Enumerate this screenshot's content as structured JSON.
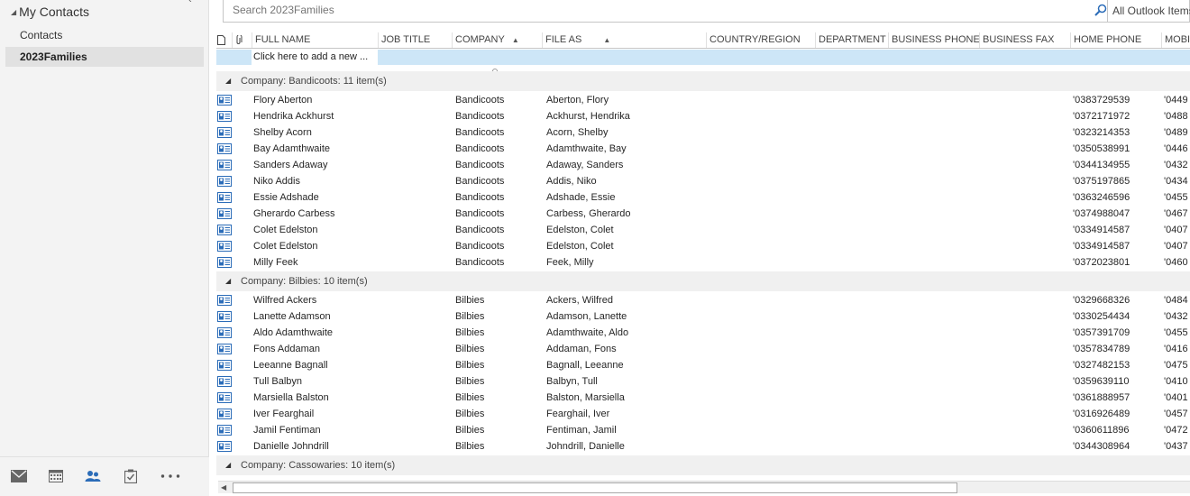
{
  "sidebar": {
    "header": "My Contacts",
    "folders": [
      {
        "label": "Contacts"
      },
      {
        "label": "2023Families"
      }
    ]
  },
  "bottom_nav": [
    "mail-icon",
    "calendar-icon",
    "people-icon",
    "tasks-icon",
    "more-icon"
  ],
  "search": {
    "placeholder": "Search 2023Families",
    "scope": "All Outlook Items"
  },
  "columns": {
    "full_name": "FULL NAME",
    "job_title": "JOB TITLE",
    "company": "COMPANY",
    "file_as": "FILE AS",
    "country": "COUNTRY/REGION",
    "department": "DEPARTMENT",
    "business_phone": "BUSINESS PHONE",
    "business_fax": "BUSINESS FAX",
    "home_phone": "HOME PHONE",
    "mobile": "MOBI"
  },
  "add_new": "Click here to add a new ...",
  "groups": [
    {
      "label": "Company: Bandicoots: 11 item(s)",
      "rows": [
        {
          "name": "Flory Aberton",
          "company": "Bandicoots",
          "file_as": "Aberton, Flory",
          "home": "'0383729539",
          "mobile": "'0449"
        },
        {
          "name": "Hendrika Ackhurst",
          "company": "Bandicoots",
          "file_as": "Ackhurst, Hendrika",
          "home": "'0372171972",
          "mobile": "'0488"
        },
        {
          "name": "Shelby Acorn",
          "company": "Bandicoots",
          "file_as": "Acorn, Shelby",
          "home": "'0323214353",
          "mobile": "'0489"
        },
        {
          "name": "Bay Adamthwaite",
          "company": "Bandicoots",
          "file_as": "Adamthwaite, Bay",
          "home": "'0350538991",
          "mobile": "'0446"
        },
        {
          "name": "Sanders Adaway",
          "company": "Bandicoots",
          "file_as": "Adaway, Sanders",
          "home": "'0344134955",
          "mobile": "'0432"
        },
        {
          "name": "Niko Addis",
          "company": "Bandicoots",
          "file_as": "Addis, Niko",
          "home": "'0375197865",
          "mobile": "'0434"
        },
        {
          "name": "Essie Adshade",
          "company": "Bandicoots",
          "file_as": "Adshade, Essie",
          "home": "'0363246596",
          "mobile": "'0455"
        },
        {
          "name": "Gherardo Carbess",
          "company": "Bandicoots",
          "file_as": "Carbess, Gherardo",
          "home": "'0374988047",
          "mobile": "'0467"
        },
        {
          "name": "Colet Edelston",
          "company": "Bandicoots",
          "file_as": "Edelston, Colet",
          "home": "'0334914587",
          "mobile": "'0407"
        },
        {
          "name": "Colet Edelston",
          "company": "Bandicoots",
          "file_as": "Edelston, Colet",
          "home": "'0334914587",
          "mobile": "'0407"
        },
        {
          "name": "Milly Feek",
          "company": "Bandicoots",
          "file_as": "Feek, Milly",
          "home": "'0372023801",
          "mobile": "'0460"
        }
      ]
    },
    {
      "label": "Company: Bilbies: 10 item(s)",
      "rows": [
        {
          "name": "Wilfred Ackers",
          "company": "Bilbies",
          "file_as": "Ackers, Wilfred",
          "home": "'0329668326",
          "mobile": "'0484"
        },
        {
          "name": "Lanette Adamson",
          "company": "Bilbies",
          "file_as": "Adamson, Lanette",
          "home": "'0330254434",
          "mobile": "'0432"
        },
        {
          "name": "Aldo Adamthwaite",
          "company": "Bilbies",
          "file_as": "Adamthwaite, Aldo",
          "home": "'0357391709",
          "mobile": "'0455"
        },
        {
          "name": "Fons Addaman",
          "company": "Bilbies",
          "file_as": "Addaman, Fons",
          "home": "'0357834789",
          "mobile": "'0416"
        },
        {
          "name": "Leeanne Bagnall",
          "company": "Bilbies",
          "file_as": "Bagnall, Leeanne",
          "home": "'0327482153",
          "mobile": "'0475"
        },
        {
          "name": "Tull Balbyn",
          "company": "Bilbies",
          "file_as": "Balbyn, Tull",
          "home": "'0359639110",
          "mobile": "'0410"
        },
        {
          "name": "Marsiella Balston",
          "company": "Bilbies",
          "file_as": "Balston, Marsiella",
          "home": "'0361888957",
          "mobile": "'0401"
        },
        {
          "name": "Iver Fearghail",
          "company": "Bilbies",
          "file_as": "Fearghail, Iver",
          "home": "'0316926489",
          "mobile": "'0457"
        },
        {
          "name": "Jamil Fentiman",
          "company": "Bilbies",
          "file_as": "Fentiman, Jamil",
          "home": "'0360611896",
          "mobile": "'0472"
        },
        {
          "name": "Danielle Johndrill",
          "company": "Bilbies",
          "file_as": "Johndrill, Danielle",
          "home": "'0344308964",
          "mobile": "'0437"
        }
      ]
    },
    {
      "label": "Company: Cassowaries: 10 item(s)",
      "rows": []
    }
  ]
}
